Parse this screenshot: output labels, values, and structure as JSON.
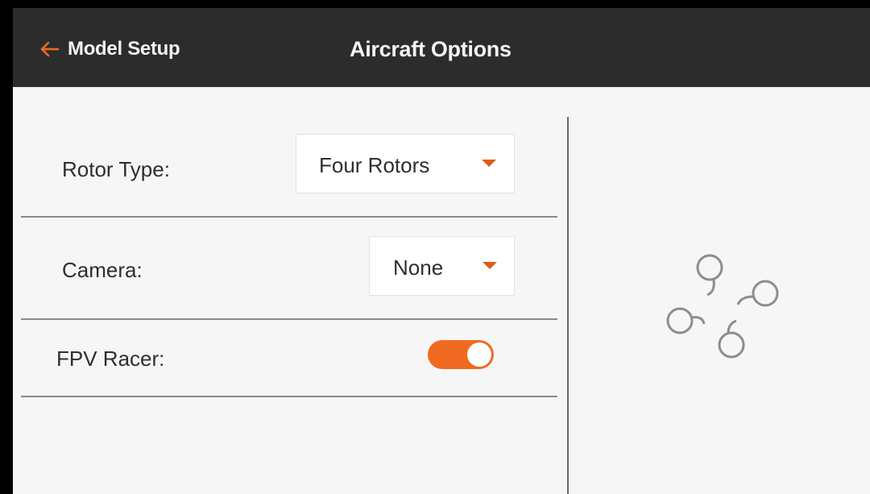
{
  "header": {
    "back_label": "Model Setup",
    "title": "Aircraft Options"
  },
  "settings": {
    "rotor_type": {
      "label": "Rotor Type:",
      "value": "Four Rotors"
    },
    "camera": {
      "label": "Camera:",
      "value": "None"
    },
    "fpv_racer": {
      "label": "FPV Racer:",
      "enabled": true
    }
  },
  "icons": {
    "back": "left-arrow-icon",
    "dropdown": "caret-down-icon",
    "aircraft_preview": "quadcopter-icon"
  },
  "colors": {
    "accent": "#f06a22",
    "header_bg": "#2c2c2c",
    "content_bg": "#f6f6f6"
  }
}
